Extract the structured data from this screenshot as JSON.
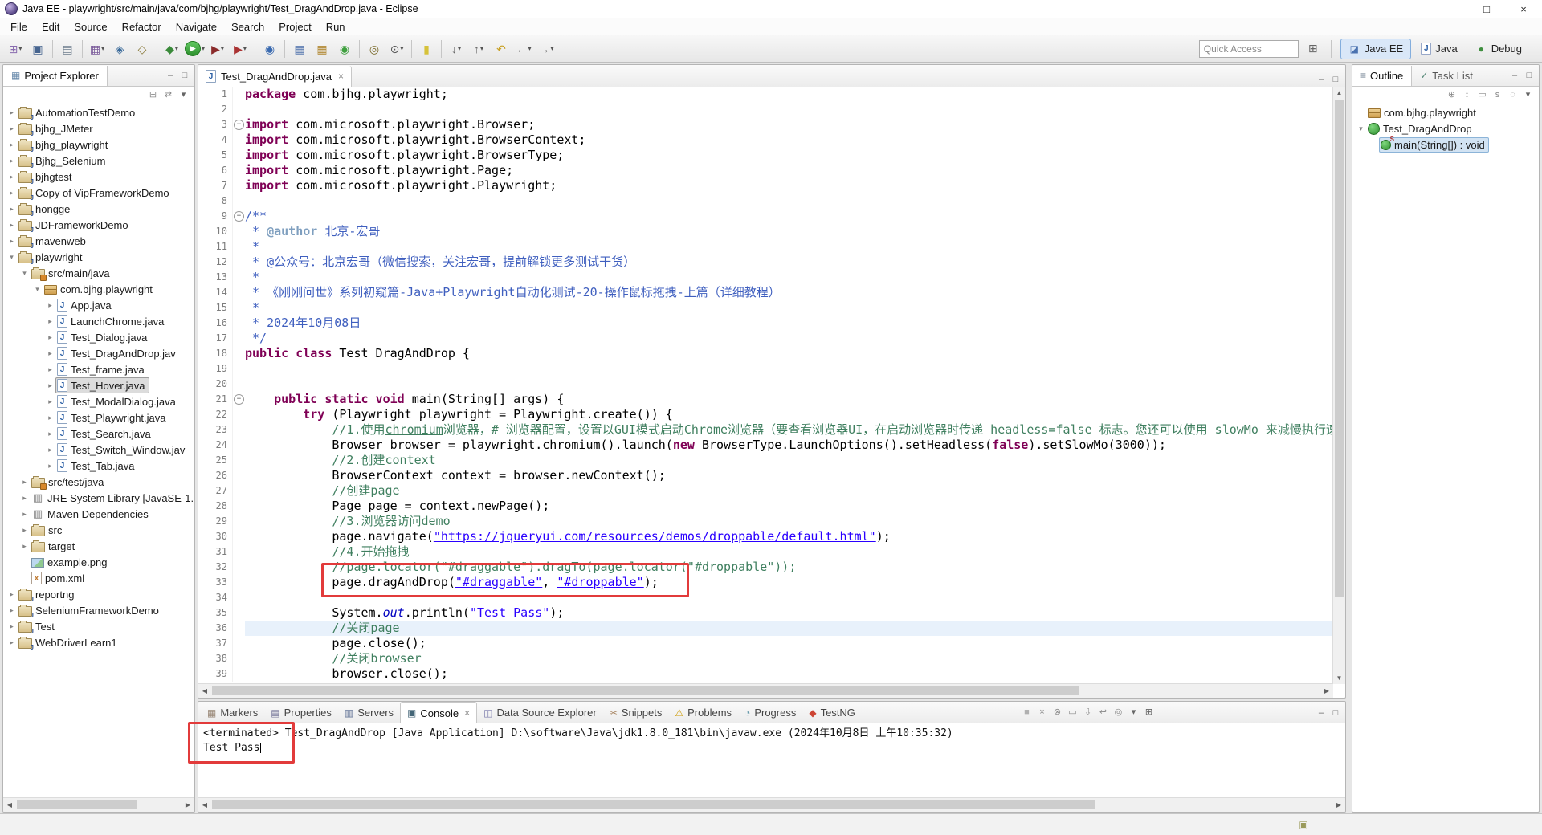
{
  "window": {
    "title": "Java EE - playwright/src/main/java/com/bjhg/playwright/Test_DragAndDrop.java - Eclipse",
    "controls": {
      "minimize": "–",
      "maximize": "□",
      "close": "×"
    }
  },
  "menubar": {
    "items": [
      "File",
      "Edit",
      "Source",
      "Refactor",
      "Navigate",
      "Search",
      "Project",
      "Run"
    ]
  },
  "toolbar": {
    "quick_access_placeholder": "Quick Access",
    "perspectives": [
      {
        "name": "java-ee",
        "label": "Java EE",
        "active": true
      },
      {
        "name": "java",
        "label": "Java",
        "active": false
      },
      {
        "name": "debug",
        "label": "Debug",
        "active": false
      }
    ],
    "icons": [
      {
        "name": "new-wizard",
        "glyph": "⊞",
        "color": "#8a6db0",
        "dd": true
      },
      {
        "name": "save",
        "glyph": "▣",
        "color": "#46648f"
      },
      {
        "sep": true
      },
      {
        "name": "print",
        "glyph": "▤",
        "color": "#6e7e8e"
      },
      {
        "sep": true
      },
      {
        "name": "new-java-ee-project",
        "glyph": "▦",
        "color": "#7a5a9a",
        "dd": true
      },
      {
        "name": "new-servlet",
        "glyph": "◈",
        "color": "#3a6a9a"
      },
      {
        "name": "new-dynamic-web-project",
        "glyph": "◇",
        "color": "#8a7a3a"
      },
      {
        "sep": true
      },
      {
        "name": "debug",
        "glyph": "◆",
        "color": "#3a8a3a",
        "dd": true
      },
      {
        "name": "run",
        "glyph": "▶",
        "color": "#ffffff",
        "circle": true,
        "dd": true
      },
      {
        "name": "coverage",
        "glyph": "▶",
        "color": "#8a2a2a",
        "dd": true
      },
      {
        "name": "external-tools",
        "glyph": "▶",
        "color": "#aa3333",
        "dd": true
      },
      {
        "sep": true
      },
      {
        "name": "open-web-browser",
        "glyph": "◉",
        "color": "#3a6ab0"
      },
      {
        "sep": true
      },
      {
        "name": "new-java-project",
        "glyph": "▦",
        "color": "#5a7ab0"
      },
      {
        "name": "new-package",
        "glyph": "▦",
        "color": "#b0862f"
      },
      {
        "name": "new-class",
        "glyph": "◉",
        "color": "#3fa03f"
      },
      {
        "sep": true
      },
      {
        "name": "open-type",
        "glyph": "◎",
        "color": "#7a6a2a"
      },
      {
        "name": "search",
        "glyph": "⊙",
        "color": "#555555",
        "dd": true
      },
      {
        "sep": true
      },
      {
        "name": "toggle-mark-occurrences",
        "glyph": "▮",
        "color": "#d6c23a"
      },
      {
        "sep": true
      },
      {
        "name": "next-annotation",
        "glyph": "↓",
        "color": "#666666",
        "dd": true
      },
      {
        "name": "previous-annotation",
        "glyph": "↑",
        "color": "#666666",
        "dd": true
      },
      {
        "name": "last-edit-location",
        "glyph": "↶",
        "color": "#c9a227"
      },
      {
        "name": "back",
        "glyph": "←",
        "color": "#666666",
        "dd": true
      },
      {
        "name": "forward",
        "glyph": "→",
        "color": "#666666",
        "dd": true
      }
    ]
  },
  "project_explorer": {
    "title": "Project Explorer",
    "toolbar_icons": [
      {
        "name": "collapse-all",
        "glyph": "⊟",
        "color": "#8a8a8a"
      },
      {
        "name": "link-with-editor",
        "glyph": "⇄",
        "color": "#8a8a8a"
      },
      {
        "name": "view-menu",
        "glyph": "▾",
        "color": "#666666"
      }
    ],
    "tree": [
      {
        "d": 0,
        "e": "c",
        "i": "proj",
        "t": "AutomationTestDemo"
      },
      {
        "d": 0,
        "e": "c",
        "i": "proj",
        "t": "bjhg_JMeter"
      },
      {
        "d": 0,
        "e": "c",
        "i": "proj",
        "t": "bjhg_playwright"
      },
      {
        "d": 0,
        "e": "c",
        "i": "proj",
        "t": "Bjhg_Selenium"
      },
      {
        "d": 0,
        "e": "c",
        "i": "proj",
        "t": "bjhgtest"
      },
      {
        "d": 0,
        "e": "c",
        "i": "proj",
        "t": "Copy of VipFrameworkDemo"
      },
      {
        "d": 0,
        "e": "c",
        "i": "proj",
        "t": "hongge"
      },
      {
        "d": 0,
        "e": "c",
        "i": "proj",
        "t": "JDFrameworkDemo"
      },
      {
        "d": 0,
        "e": "c",
        "i": "proj",
        "t": "mavenweb"
      },
      {
        "d": 0,
        "e": "o",
        "i": "proj",
        "t": "playwright"
      },
      {
        "d": 1,
        "e": "o",
        "i": "srcfolder",
        "t": "src/main/java"
      },
      {
        "d": 2,
        "e": "o",
        "i": "pkg",
        "t": "com.bjhg.playwright"
      },
      {
        "d": 3,
        "e": "c",
        "i": "java",
        "t": "App.java"
      },
      {
        "d": 3,
        "e": "c",
        "i": "java",
        "t": "LaunchChrome.java"
      },
      {
        "d": 3,
        "e": "c",
        "i": "java",
        "t": "Test_Dialog.java"
      },
      {
        "d": 3,
        "e": "c",
        "i": "java",
        "t": "Test_DragAndDrop.jav"
      },
      {
        "d": 3,
        "e": "c",
        "i": "java",
        "t": "Test_frame.java"
      },
      {
        "d": 3,
        "e": "c",
        "i": "java",
        "t": "Test_Hover.java",
        "sel": true
      },
      {
        "d": 3,
        "e": "c",
        "i": "java",
        "t": "Test_ModalDialog.java"
      },
      {
        "d": 3,
        "e": "c",
        "i": "java",
        "t": "Test_Playwright.java"
      },
      {
        "d": 3,
        "e": "c",
        "i": "java",
        "t": "Test_Search.java"
      },
      {
        "d": 3,
        "e": "c",
        "i": "java",
        "t": "Test_Switch_Window.jav"
      },
      {
        "d": 3,
        "e": "c",
        "i": "java",
        "t": "Test_Tab.java"
      },
      {
        "d": 1,
        "e": "c",
        "i": "srcfolder",
        "t": "src/test/java"
      },
      {
        "d": 1,
        "e": "c",
        "i": "lib",
        "t": "JRE System Library [JavaSE-1."
      },
      {
        "d": 1,
        "e": "c",
        "i": "lib",
        "t": "Maven Dependencies"
      },
      {
        "d": 1,
        "e": "c",
        "i": "folder",
        "t": "src"
      },
      {
        "d": 1,
        "e": "c",
        "i": "folder",
        "t": "target"
      },
      {
        "d": 1,
        "e": null,
        "i": "img",
        "t": "example.png"
      },
      {
        "d": 1,
        "e": null,
        "i": "xml",
        "t": "pom.xml"
      },
      {
        "d": 0,
        "e": "c",
        "i": "proj",
        "t": "reportng"
      },
      {
        "d": 0,
        "e": "c",
        "i": "proj",
        "t": "SeleniumFrameworkDemo"
      },
      {
        "d": 0,
        "e": "c",
        "i": "proj",
        "t": "Test"
      },
      {
        "d": 0,
        "e": "c",
        "i": "proj",
        "t": "WebDriverLearn1"
      }
    ]
  },
  "editor": {
    "tab_title": "Test_DragAndDrop.java",
    "lines": [
      {
        "n": 1,
        "s": [
          [
            "k",
            "package"
          ],
          [
            "p",
            " com.bjhg.playwright;"
          ]
        ]
      },
      {
        "n": 2,
        "s": []
      },
      {
        "n": 3,
        "f": 1,
        "s": [
          [
            "k",
            "import"
          ],
          [
            "p",
            " com.microsoft.playwright.Browser;"
          ]
        ]
      },
      {
        "n": 4,
        "s": [
          [
            "k",
            "import"
          ],
          [
            "p",
            " com.microsoft.playwright.BrowserContext;"
          ]
        ]
      },
      {
        "n": 5,
        "s": [
          [
            "k",
            "import"
          ],
          [
            "p",
            " com.microsoft.playwright.BrowserType;"
          ]
        ]
      },
      {
        "n": 6,
        "s": [
          [
            "k",
            "import"
          ],
          [
            "p",
            " com.microsoft.playwright.Page;"
          ]
        ]
      },
      {
        "n": 7,
        "s": [
          [
            "k",
            "import"
          ],
          [
            "p",
            " com.microsoft.playwright.Playwright;"
          ]
        ]
      },
      {
        "n": 8,
        "s": []
      },
      {
        "n": 9,
        "f": 1,
        "s": [
          [
            "j",
            "/**"
          ]
        ]
      },
      {
        "n": 10,
        "s": [
          [
            "j",
            " * "
          ],
          [
            "jt",
            "@author"
          ],
          [
            "j",
            " 北京-宏哥"
          ]
        ]
      },
      {
        "n": 11,
        "s": [
          [
            "j",
            " *"
          ]
        ]
      },
      {
        "n": 12,
        "s": [
          [
            "j",
            " * @公众号：北京宏哥（微信搜索，关注宏哥，提前解锁更多测试干货）"
          ]
        ]
      },
      {
        "n": 13,
        "s": [
          [
            "j",
            " *"
          ]
        ]
      },
      {
        "n": 14,
        "s": [
          [
            "j",
            " * 《刚刚问世》系列初窥篇-Java+Playwright自动化测试-20-操作鼠标拖拽-上篇（详细教程）"
          ]
        ]
      },
      {
        "n": 15,
        "s": [
          [
            "j",
            " *"
          ]
        ]
      },
      {
        "n": 16,
        "s": [
          [
            "j",
            " * 2024年10月08日"
          ]
        ]
      },
      {
        "n": 17,
        "s": [
          [
            "j",
            " */"
          ]
        ]
      },
      {
        "n": 18,
        "s": [
          [
            "k",
            "public"
          ],
          [
            "p",
            " "
          ],
          [
            "k",
            "class"
          ],
          [
            "p",
            " Test_DragAndDrop {"
          ]
        ]
      },
      {
        "n": 19,
        "s": []
      },
      {
        "n": 20,
        "s": []
      },
      {
        "n": 21,
        "f": 1,
        "s": [
          [
            "p",
            "    "
          ],
          [
            "k",
            "public"
          ],
          [
            "p",
            " "
          ],
          [
            "k",
            "static"
          ],
          [
            "p",
            " "
          ],
          [
            "k",
            "void"
          ],
          [
            "p",
            " main(String[] args) {"
          ]
        ]
      },
      {
        "n": 22,
        "s": [
          [
            "p",
            "        "
          ],
          [
            "k",
            "try"
          ],
          [
            "p",
            " (Playwright playwright = Playwright.create()) {"
          ]
        ]
      },
      {
        "n": 23,
        "s": [
          [
            "p",
            "            "
          ],
          [
            "c",
            "//1.使用"
          ],
          [
            "cu",
            "chromium"
          ],
          [
            "c",
            "浏览器，# 浏览器配置，设置以GUI模式启动Chrome浏览器（要查看浏览器UI，在启动浏览器时传递 headless=false 标志。您还可以使用 slowMo 来减慢执行速度。"
          ]
        ]
      },
      {
        "n": 24,
        "s": [
          [
            "p",
            "            Browser browser = playwright.chromium().launch("
          ],
          [
            "k",
            "new"
          ],
          [
            "p",
            " BrowserType.LaunchOptions().setHeadless("
          ],
          [
            "k",
            "false"
          ],
          [
            "p",
            ").setSlowMo(3000));"
          ]
        ]
      },
      {
        "n": 25,
        "s": [
          [
            "p",
            "            "
          ],
          [
            "c",
            "//2.创建context"
          ]
        ]
      },
      {
        "n": 26,
        "s": [
          [
            "p",
            "            BrowserContext context = browser.newContext();"
          ]
        ]
      },
      {
        "n": 27,
        "s": [
          [
            "p",
            "            "
          ],
          [
            "c",
            "//创建page"
          ]
        ]
      },
      {
        "n": 28,
        "s": [
          [
            "p",
            "            Page page = context.newPage();"
          ]
        ]
      },
      {
        "n": 29,
        "s": [
          [
            "p",
            "            "
          ],
          [
            "c",
            "//3.浏览器访问demo"
          ]
        ]
      },
      {
        "n": 30,
        "s": [
          [
            "p",
            "            page.navigate("
          ],
          [
            "su",
            "\"https://jqueryui.com/resources/demos/droppable/default.html\""
          ],
          [
            "p",
            ");"
          ]
        ]
      },
      {
        "n": 31,
        "s": [
          [
            "p",
            "            "
          ],
          [
            "c",
            "//4.开始拖拽"
          ]
        ]
      },
      {
        "n": 32,
        "s": [
          [
            "p",
            "            "
          ],
          [
            "c",
            "//page.locator("
          ],
          [
            "cu",
            "\"#draggable\""
          ],
          [
            "c",
            ").dragTo(page.locator("
          ],
          [
            "cu",
            "\"#droppable\""
          ],
          [
            "c",
            "));"
          ]
        ]
      },
      {
        "n": 33,
        "s": [
          [
            "p",
            "            page.dragAndDrop("
          ],
          [
            "su",
            "\"#draggable\""
          ],
          [
            "p",
            ", "
          ],
          [
            "su",
            "\"#droppable\""
          ],
          [
            "p",
            ");"
          ]
        ]
      },
      {
        "n": 34,
        "s": []
      },
      {
        "n": 35,
        "s": [
          [
            "p",
            "            System."
          ],
          [
            "fi",
            "out"
          ],
          [
            "p",
            ".println("
          ],
          [
            "s",
            "\"Test Pass\""
          ],
          [
            "p",
            ");"
          ]
        ]
      },
      {
        "n": 36,
        "hl": 1,
        "s": [
          [
            "p",
            "            "
          ],
          [
            "c",
            "//关闭page"
          ]
        ]
      },
      {
        "n": 37,
        "s": [
          [
            "p",
            "            page.close();"
          ]
        ]
      },
      {
        "n": 38,
        "s": [
          [
            "p",
            "            "
          ],
          [
            "c",
            "//关闭browser"
          ]
        ]
      },
      {
        "n": 39,
        "s": [
          [
            "p",
            "            browser.close();"
          ]
        ]
      }
    ]
  },
  "outline": {
    "tabs": [
      {
        "label": "Outline",
        "glyph": "≡",
        "color": "#667788",
        "active": true
      },
      {
        "label": "Task List",
        "glyph": "✓",
        "color": "#558877",
        "active": false
      }
    ],
    "toolbar_icons": [
      {
        "name": "expand-all",
        "glyph": "⊕",
        "color": "#8a8a8a"
      },
      {
        "name": "sort",
        "glyph": "↕",
        "color": "#8a8a8a"
      },
      {
        "name": "hide-fields",
        "glyph": "▭",
        "color": "#8a8a8a"
      },
      {
        "name": "hide-static",
        "glyph": "s",
        "color": "#8a8a8a"
      },
      {
        "name": "hide-non-public",
        "glyph": "◌",
        "color": "#8a8a8a"
      },
      {
        "name": "view-menu",
        "glyph": "▾",
        "color": "#666666"
      }
    ],
    "tree": [
      {
        "d": 0,
        "e": null,
        "i": "pkg",
        "t": "com.bjhg.playwright"
      },
      {
        "d": 0,
        "e": "o",
        "i": "class",
        "t": "Test_DragAndDrop"
      },
      {
        "d": 1,
        "e": null,
        "i": "method",
        "t": "main(String[]) : void",
        "sel": true
      }
    ]
  },
  "console": {
    "tabs": [
      {
        "label": "Markers",
        "glyph": "▦",
        "color": "#998877"
      },
      {
        "label": "Properties",
        "glyph": "▤",
        "color": "#777799"
      },
      {
        "label": "Servers",
        "glyph": "▥",
        "color": "#667799"
      },
      {
        "label": "Console",
        "glyph": "▣",
        "color": "#446677",
        "active": true
      },
      {
        "label": "Data Source Explorer",
        "glyph": "◫",
        "color": "#7777aa"
      },
      {
        "label": "Snippets",
        "glyph": "✂",
        "color": "#aa8866"
      },
      {
        "label": "Problems",
        "glyph": "⚠",
        "color": "#cc9900"
      },
      {
        "label": "Progress",
        "glyph": "◔",
        "color": "#6699aa"
      },
      {
        "label": "TestNG",
        "glyph": "◆",
        "color": "#cc4433"
      }
    ],
    "toolbar_icons": [
      {
        "name": "terminate",
        "glyph": "■",
        "color": "#b0b0b0"
      },
      {
        "name": "remove-launch",
        "glyph": "×",
        "color": "#8a8a8a"
      },
      {
        "name": "remove-all-terminated",
        "glyph": "⊗",
        "color": "#8a8a8a"
      },
      {
        "name": "clear-console",
        "glyph": "▭",
        "color": "#8a8a8a"
      },
      {
        "name": "scroll-lock",
        "glyph": "⇩",
        "color": "#8a8a8a"
      },
      {
        "name": "word-wrap",
        "glyph": "↩",
        "color": "#8a8a8a"
      },
      {
        "name": "pin-console",
        "glyph": "◎",
        "color": "#8a8a8a"
      },
      {
        "name": "display-selected-console",
        "glyph": "▾",
        "color": "#666666"
      },
      {
        "name": "open-console",
        "glyph": "⊞",
        "color": "#666666"
      }
    ],
    "header_label": "<terminated> Test_DragAndDrop [Java Application] D:\\software\\Java\\jdk1.8.0_181\\bin\\javaw.exe (2024年10月8日 上午10:35:32)",
    "output": "Test Pass"
  }
}
